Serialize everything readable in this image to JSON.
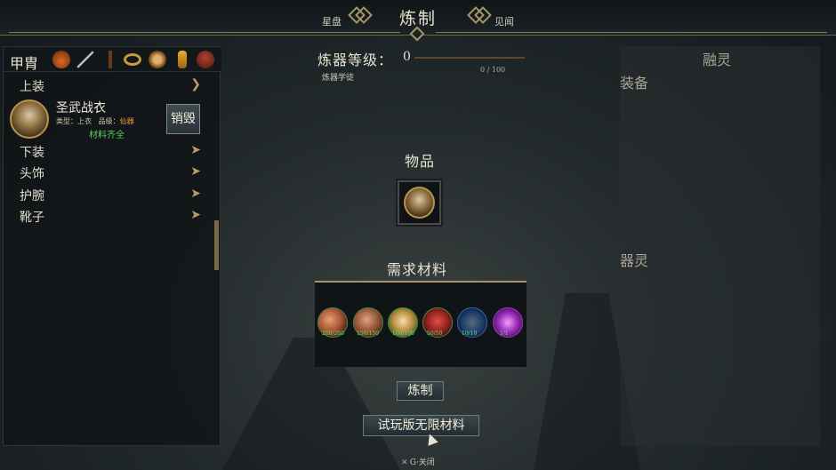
{
  "header": {
    "title": "炼制",
    "left_tab": "星盘",
    "right_tab": "见闻"
  },
  "left_panel": {
    "category_label": "甲胄",
    "category_icons": [
      "gourd-icon",
      "sword-icon",
      "staff-icon",
      "ring-icon",
      "amulet-icon",
      "talisman-icon",
      "armor-icon"
    ],
    "groups": [
      {
        "label": "上装",
        "expanded": true
      },
      {
        "label": "下装",
        "expanded": false
      },
      {
        "label": "头饰",
        "expanded": false
      },
      {
        "label": "护腕",
        "expanded": false
      },
      {
        "label": "靴子",
        "expanded": false
      }
    ],
    "selected_item": {
      "name": "圣武战衣",
      "type_label": "类型：",
      "type_value": "上衣",
      "grade_label": "品级：",
      "grade_value": "仙器",
      "status": "材料齐全",
      "destroy_label": "销毁"
    }
  },
  "center": {
    "level_label": "炼器等级：",
    "level_value": "0",
    "level_progress": 0,
    "level_count": "0 / 100",
    "level_sub": "炼器学徒",
    "item_title": "物品",
    "materials_title": "需求材料",
    "materials": [
      {
        "name": "copper-ore-icon",
        "count": "260/260"
      },
      {
        "name": "leather-icon",
        "count": "150/150"
      },
      {
        "name": "jade-icon",
        "count": "100/100"
      },
      {
        "name": "cinnabar-icon",
        "count": "50/50"
      },
      {
        "name": "feather-icon",
        "count": "10/10"
      },
      {
        "name": "spirit-crystal-icon",
        "count": "1/1"
      }
    ],
    "craft_button": "炼制",
    "trial_button": "试玩版无限材料"
  },
  "right_panel": {
    "title": "融灵",
    "equip_label": "装备",
    "spirit_label": "器灵"
  },
  "footer": {
    "key": "G",
    "separator": "·",
    "action": "关闭"
  },
  "colors": {
    "accent_gold": "#a89466",
    "complete_green": "#5cd05c",
    "grade_orange": "#e6a23c"
  }
}
